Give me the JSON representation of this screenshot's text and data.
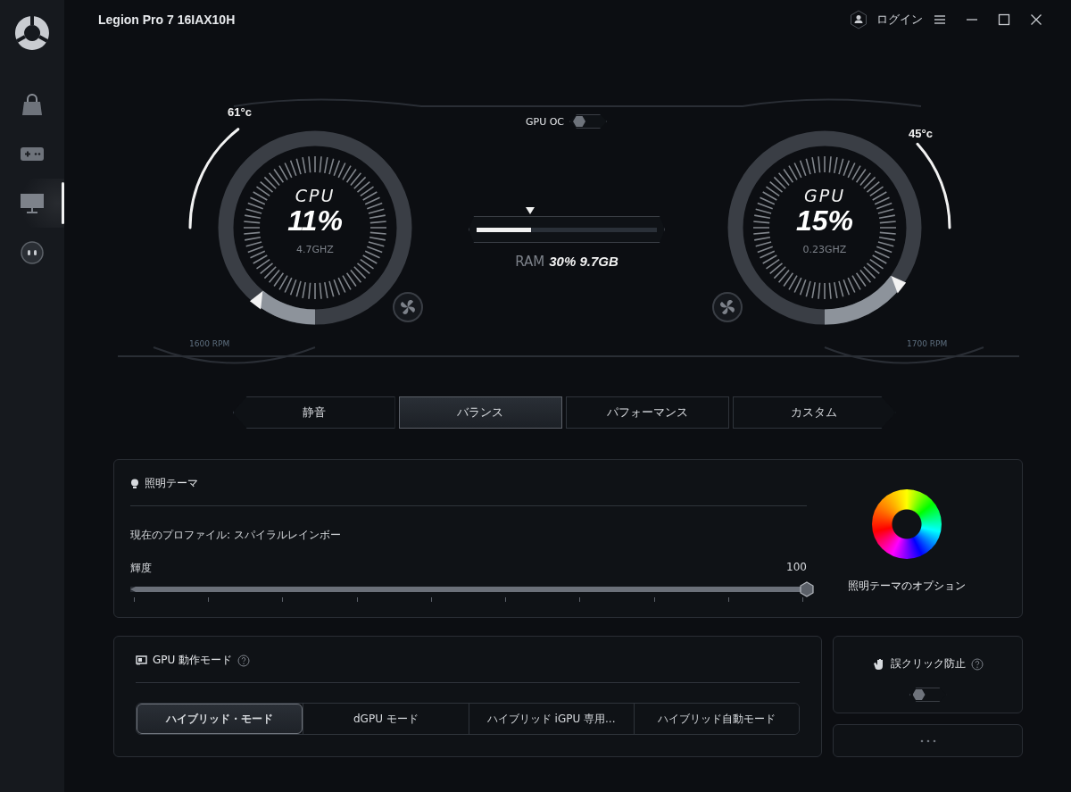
{
  "sidebar": {
    "items": [
      {
        "kind": "store",
        "selected": false
      },
      {
        "kind": "game",
        "selected": false
      },
      {
        "kind": "display",
        "selected": true
      },
      {
        "kind": "face",
        "selected": false
      }
    ]
  },
  "titlebar": {
    "title": "Legion Pro 7 16IAX10H",
    "login": "ログイン"
  },
  "dashboard": {
    "gpu_oc": {
      "label": "GPU OC",
      "on": false
    },
    "gauges": [
      {
        "name": "CPU",
        "usage": "11%",
        "frequency": "4.7GHZ",
        "level": 0.11,
        "temperature": "61°c",
        "fan_speed": "1600 RPM"
      },
      {
        "name": "GPU",
        "usage": "15%",
        "frequency": "0.23GHZ",
        "level": 0.15,
        "temperature": "45°c",
        "fan_speed": "1700 RPM"
      }
    ],
    "ram": {
      "label": "RAM",
      "reading": "30% 9.7GB",
      "level": 0.3
    }
  },
  "power_modes": [
    {
      "label": "静音",
      "selected": false
    },
    {
      "label": "バランス",
      "selected": true
    },
    {
      "label": "パフォーマンス",
      "selected": false
    },
    {
      "label": "カスタム",
      "selected": false
    }
  ],
  "lighting": {
    "title": "照明テーマ",
    "profile": "現在のプロファイル: スパイラルレインボー",
    "brightness": {
      "label": "輝度",
      "value": "100",
      "level": 1.0
    },
    "options_label": "照明テーマのオプション"
  },
  "gpu_mode": {
    "title": "GPU 動作モード",
    "modes": [
      {
        "label": "ハイブリッド・モード",
        "selected": true
      },
      {
        "label": "dGPU モード",
        "selected": false
      },
      {
        "label": "ハイブリッド iGPU 専用...",
        "selected": false
      },
      {
        "label": "ハイブリッド自動モード",
        "selected": false
      }
    ]
  },
  "misclick": {
    "title": "誤クリック防止",
    "on": false
  }
}
